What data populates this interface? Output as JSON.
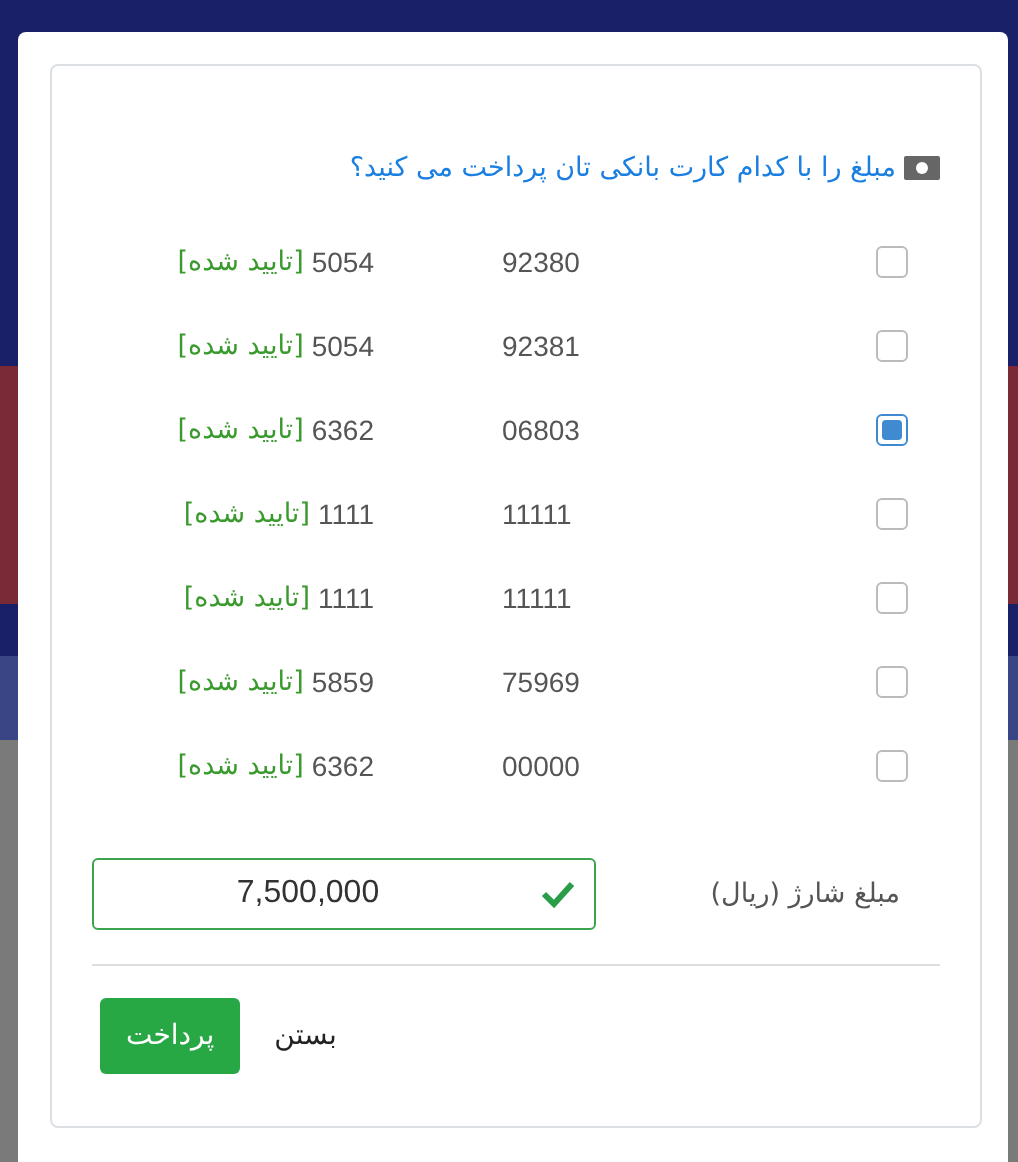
{
  "dialog": {
    "question": "مبلغ را با کدام کارت بانکی تان پرداخت می کنید؟",
    "cards": [
      {
        "number": "92380",
        "card": "5054",
        "status": "[تایید شده]",
        "selected": false
      },
      {
        "number": "92381",
        "card": "5054",
        "status": "[تایید شده]",
        "selected": false
      },
      {
        "number": "06803",
        "card": "6362",
        "status": "[تایید شده]",
        "selected": true
      },
      {
        "number": "11111",
        "card": "1111",
        "status": "[تایید شده]",
        "selected": false
      },
      {
        "number": "11111",
        "card": "1111",
        "status": "[تایید شده]",
        "selected": false
      },
      {
        "number": "75969",
        "card": "5859",
        "status": "[تایید شده]",
        "selected": false
      },
      {
        "number": "00000",
        "card": "6362",
        "status": "[تایید شده]",
        "selected": false
      }
    ],
    "amount": {
      "label": "مبلغ شارژ (ریال)",
      "value": "7,500,000",
      "valid": true
    },
    "buttons": [
      {
        "label": "بستن",
        "kind": "plain"
      },
      {
        "label": "پرداخت",
        "kind": "primary"
      }
    ]
  }
}
